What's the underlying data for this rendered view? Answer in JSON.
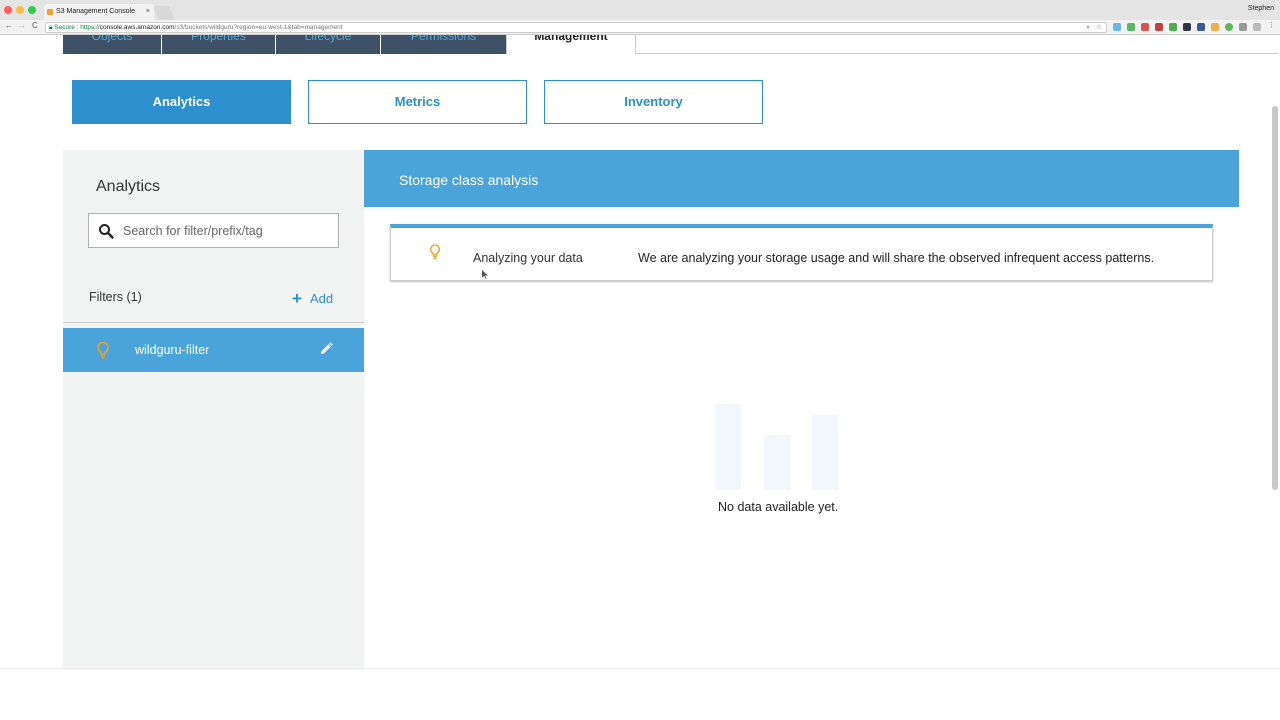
{
  "browser": {
    "tab_title": "S3 Management Console",
    "tab_close": "×",
    "profile_name": "Stephen",
    "secure_label": "Secure",
    "url_scheme": "https://",
    "url_host": "console.aws.amazon.com",
    "url_path": "/s3/buckets/wildguru?region=eu-west-1&tab=management",
    "back_glyph": "←",
    "forward_glyph": "→",
    "reload_glyph": "C",
    "colors": {
      "close": "#fc605c",
      "minimize": "#fdbc40",
      "maximize": "#34c84a"
    }
  },
  "service_tabs": [
    {
      "label": "Objects"
    },
    {
      "label": "Properties"
    },
    {
      "label": "Lifecycle"
    },
    {
      "label": "Permissions"
    },
    {
      "label": "Management",
      "active": true
    }
  ],
  "sub_tabs": [
    {
      "label": "Analytics",
      "active": true
    },
    {
      "label": "Metrics"
    },
    {
      "label": "Inventory"
    }
  ],
  "sidebar": {
    "title": "Analytics",
    "search_placeholder": "Search for filter/prefix/tag",
    "search_icon": "search-icon",
    "filters_label": "Filters (1)",
    "add_label": "Add",
    "add_icon": "plus-icon",
    "filters": [
      {
        "name": "wildguru-filter",
        "icon": "lightbulb-icon",
        "edit_icon": "pencil-icon"
      }
    ]
  },
  "main": {
    "header_title": "Storage class analysis",
    "status_icon": "lightbulb-icon",
    "status_title": "Analyzing your data",
    "status_message": "We are analyzing your storage usage and will share the observed infrequent access patterns.",
    "empty_text": "No data available yet.",
    "empty_icon": "bar-chart-placeholder-icon"
  },
  "colors": {
    "accent": "#2e8fcf",
    "header_blue": "#4aa4da",
    "nav_dark": "#3f5166",
    "bulb_orange": "#f0a020",
    "panel_gray": "#f2f3f3"
  }
}
